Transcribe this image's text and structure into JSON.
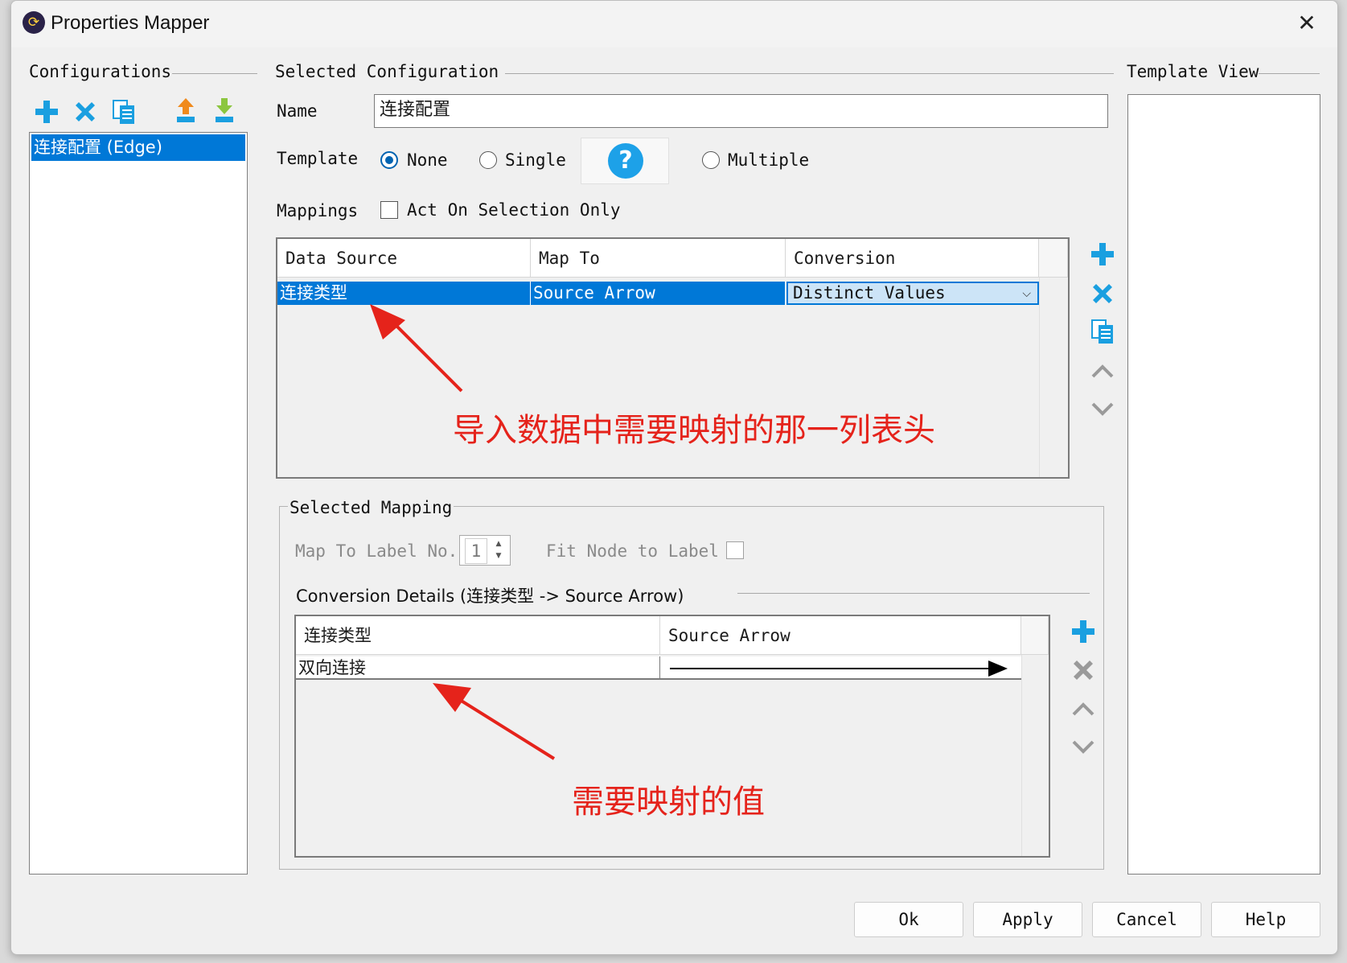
{
  "window": {
    "title": "Properties Mapper",
    "close_glyph": "✕"
  },
  "configurations": {
    "title": "Configurations",
    "toolbar": [
      "add-icon",
      "delete-icon",
      "copy-icon",
      "export-icon",
      "import-icon"
    ],
    "items": [
      {
        "label": "连接配置 (Edge)",
        "selected": true
      }
    ]
  },
  "selected_configuration": {
    "title": "Selected Configuration",
    "name_label": "Name",
    "name_value": "连接配置",
    "template_label": "Template",
    "template_options": [
      {
        "label": "None",
        "selected": true
      },
      {
        "label": "Single",
        "selected": false
      },
      {
        "label": "Multiple",
        "selected": false
      }
    ],
    "help_glyph": "?",
    "mappings_label": "Mappings",
    "act_on_selection_label": "Act On Selection Only",
    "act_on_selection_checked": false,
    "table": {
      "headers": [
        "Data Source",
        "Map To",
        "Conversion"
      ],
      "rows": [
        {
          "data_source": "连接类型",
          "map_to": "Source Arrow",
          "conversion": "Distinct Values"
        }
      ]
    },
    "side_toolbar": [
      "add-icon",
      "delete-icon",
      "copy-icon",
      "move-up-icon",
      "move-down-icon"
    ]
  },
  "selected_mapping": {
    "title": "Selected Mapping",
    "map_to_label_text": "Map To Label No.",
    "map_to_label_value": "1",
    "fit_node_label": "Fit Node to Label",
    "fit_node_checked": false,
    "conversion_details_title": "Conversion Details (连接类型 -> Source Arrow)",
    "table": {
      "headers": [
        "连接类型",
        "Source Arrow"
      ],
      "rows": [
        {
          "value": "双向连接",
          "arrow": "line-with-filled-arrow-right"
        }
      ]
    },
    "side_toolbar": [
      "add-icon",
      "delete-icon",
      "move-up-icon",
      "move-down-icon"
    ]
  },
  "template_view": {
    "title": "Template View"
  },
  "annotations": {
    "top_note": "导入数据中需要映射的那一列表头",
    "bottom_note": "需要映射的值",
    "color": "#e5231b"
  },
  "buttons": {
    "ok": "Ok",
    "apply": "Apply",
    "cancel": "Cancel",
    "help": "Help"
  },
  "colors": {
    "selection": "#0078d7",
    "icon_blue": "#1a9fe0",
    "dropdown_bg": "#cce4f7",
    "window_bg": "#f0f0f0"
  }
}
